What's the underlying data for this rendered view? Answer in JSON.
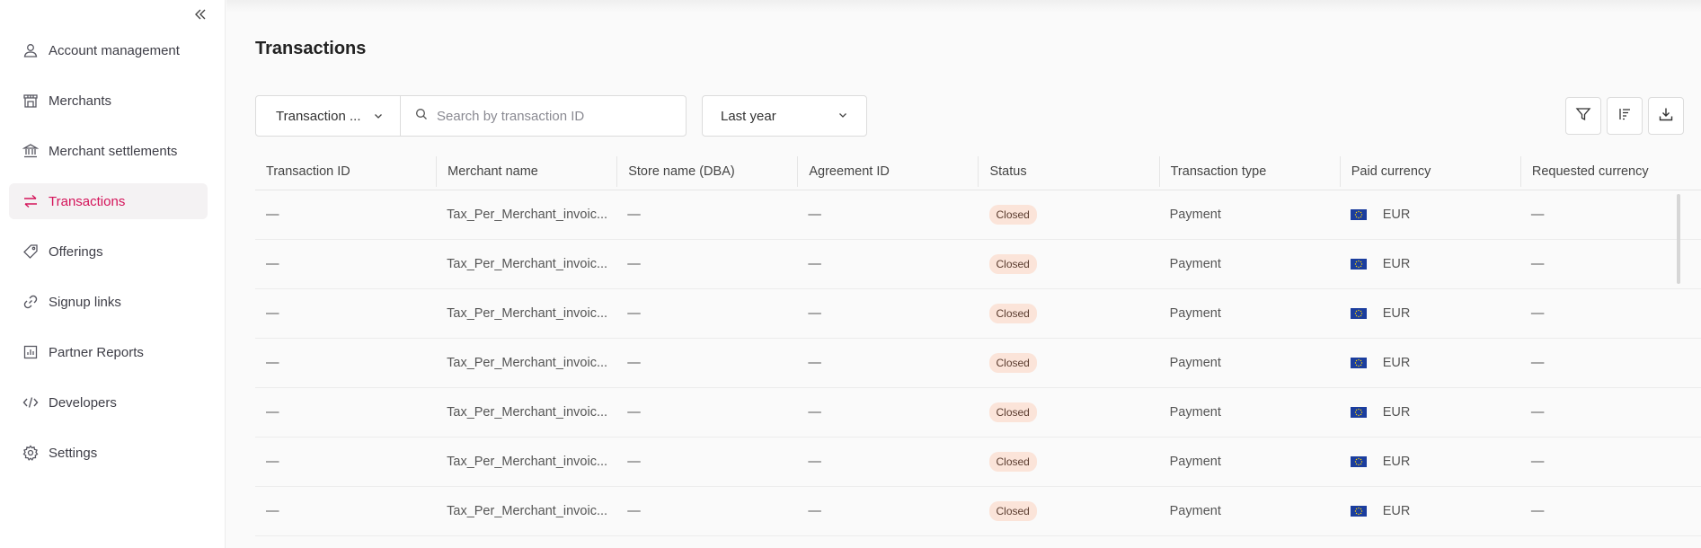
{
  "sidebar": {
    "items": [
      {
        "label": "Account management",
        "icon": "user-icon",
        "active": false
      },
      {
        "label": "Merchants",
        "icon": "store-icon",
        "active": false
      },
      {
        "label": "Merchant settlements",
        "icon": "bank-icon",
        "active": false
      },
      {
        "label": "Transactions",
        "icon": "transfer-arrows-icon",
        "active": true
      },
      {
        "label": "Offerings",
        "icon": "tag-icon",
        "active": false
      },
      {
        "label": "Signup links",
        "icon": "link-icon",
        "active": false
      },
      {
        "label": "Partner Reports",
        "icon": "bar-chart-icon",
        "active": false
      },
      {
        "label": "Developers",
        "icon": "code-icon",
        "active": false
      },
      {
        "label": "Settings",
        "icon": "gear-icon",
        "active": false
      }
    ],
    "accent_color": "#d4145a"
  },
  "page": {
    "title": "Transactions"
  },
  "toolbar": {
    "type_select": "Transaction ...",
    "search_placeholder": "Search by transaction ID",
    "search_value": "",
    "period_select": "Last year"
  },
  "table": {
    "columns": [
      "Transaction ID",
      "Merchant name",
      "Store name (DBA)",
      "Agreement ID",
      "Status",
      "Transaction type",
      "Paid currency",
      "Requested currency"
    ],
    "rows": [
      {
        "transaction_id": "—",
        "merchant_name": "Tax_Per_Merchant_invoic...",
        "store_name": "—",
        "agreement_id": "—",
        "status": "Closed",
        "transaction_type": "Payment",
        "paid_currency": "EUR",
        "requested_currency": "—"
      },
      {
        "transaction_id": "—",
        "merchant_name": "Tax_Per_Merchant_invoic...",
        "store_name": "—",
        "agreement_id": "—",
        "status": "Closed",
        "transaction_type": "Payment",
        "paid_currency": "EUR",
        "requested_currency": "—"
      },
      {
        "transaction_id": "—",
        "merchant_name": "Tax_Per_Merchant_invoic...",
        "store_name": "—",
        "agreement_id": "—",
        "status": "Closed",
        "transaction_type": "Payment",
        "paid_currency": "EUR",
        "requested_currency": "—"
      },
      {
        "transaction_id": "—",
        "merchant_name": "Tax_Per_Merchant_invoic...",
        "store_name": "—",
        "agreement_id": "—",
        "status": "Closed",
        "transaction_type": "Payment",
        "paid_currency": "EUR",
        "requested_currency": "—"
      },
      {
        "transaction_id": "—",
        "merchant_name": "Tax_Per_Merchant_invoic...",
        "store_name": "—",
        "agreement_id": "—",
        "status": "Closed",
        "transaction_type": "Payment",
        "paid_currency": "EUR",
        "requested_currency": "—"
      },
      {
        "transaction_id": "—",
        "merchant_name": "Tax_Per_Merchant_invoic...",
        "store_name": "—",
        "agreement_id": "—",
        "status": "Closed",
        "transaction_type": "Payment",
        "paid_currency": "EUR",
        "requested_currency": "—"
      },
      {
        "transaction_id": "—",
        "merchant_name": "Tax_Per_Merchant_invoic...",
        "store_name": "—",
        "agreement_id": "—",
        "status": "Closed",
        "transaction_type": "Payment",
        "paid_currency": "EUR",
        "requested_currency": "—"
      }
    ]
  }
}
